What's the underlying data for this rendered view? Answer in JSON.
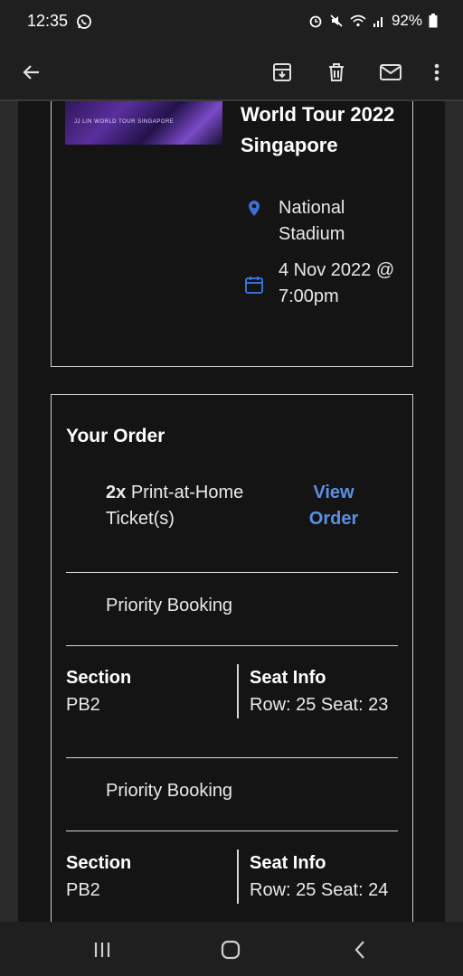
{
  "status": {
    "time": "12:35",
    "battery": "92%"
  },
  "appbar": {
    "back": "back-arrow-icon",
    "archive": "archive-icon",
    "delete": "trash-icon",
    "mark_unread": "mail-icon",
    "more": "more-vert-icon"
  },
  "event": {
    "poster_text": "JJ LIN WORLD TOUR SINGAPORE",
    "title": "World Tour 2022 Singapore",
    "venue": "National Stadium",
    "datetime": "4 Nov 2022 @ 7:00pm"
  },
  "order": {
    "heading": "Your Order",
    "quantity": "2x",
    "ticket_type": "Print-at-Home Ticket(s)",
    "view_order": "View Order",
    "items": [
      {
        "booking": "Priority Booking",
        "section_label": "Section",
        "section": "PB2",
        "seat_label": "Seat Info",
        "seat": "Row: 25 Seat: 23"
      },
      {
        "booking": "Priority Booking",
        "section_label": "Section",
        "section": "PB2",
        "seat_label": "Seat Info",
        "seat": "Row: 25 Seat: 24"
      }
    ]
  },
  "colors": {
    "link": "#5b8fe6",
    "icon_blue": "#3b6fd1",
    "background": "#141414"
  }
}
